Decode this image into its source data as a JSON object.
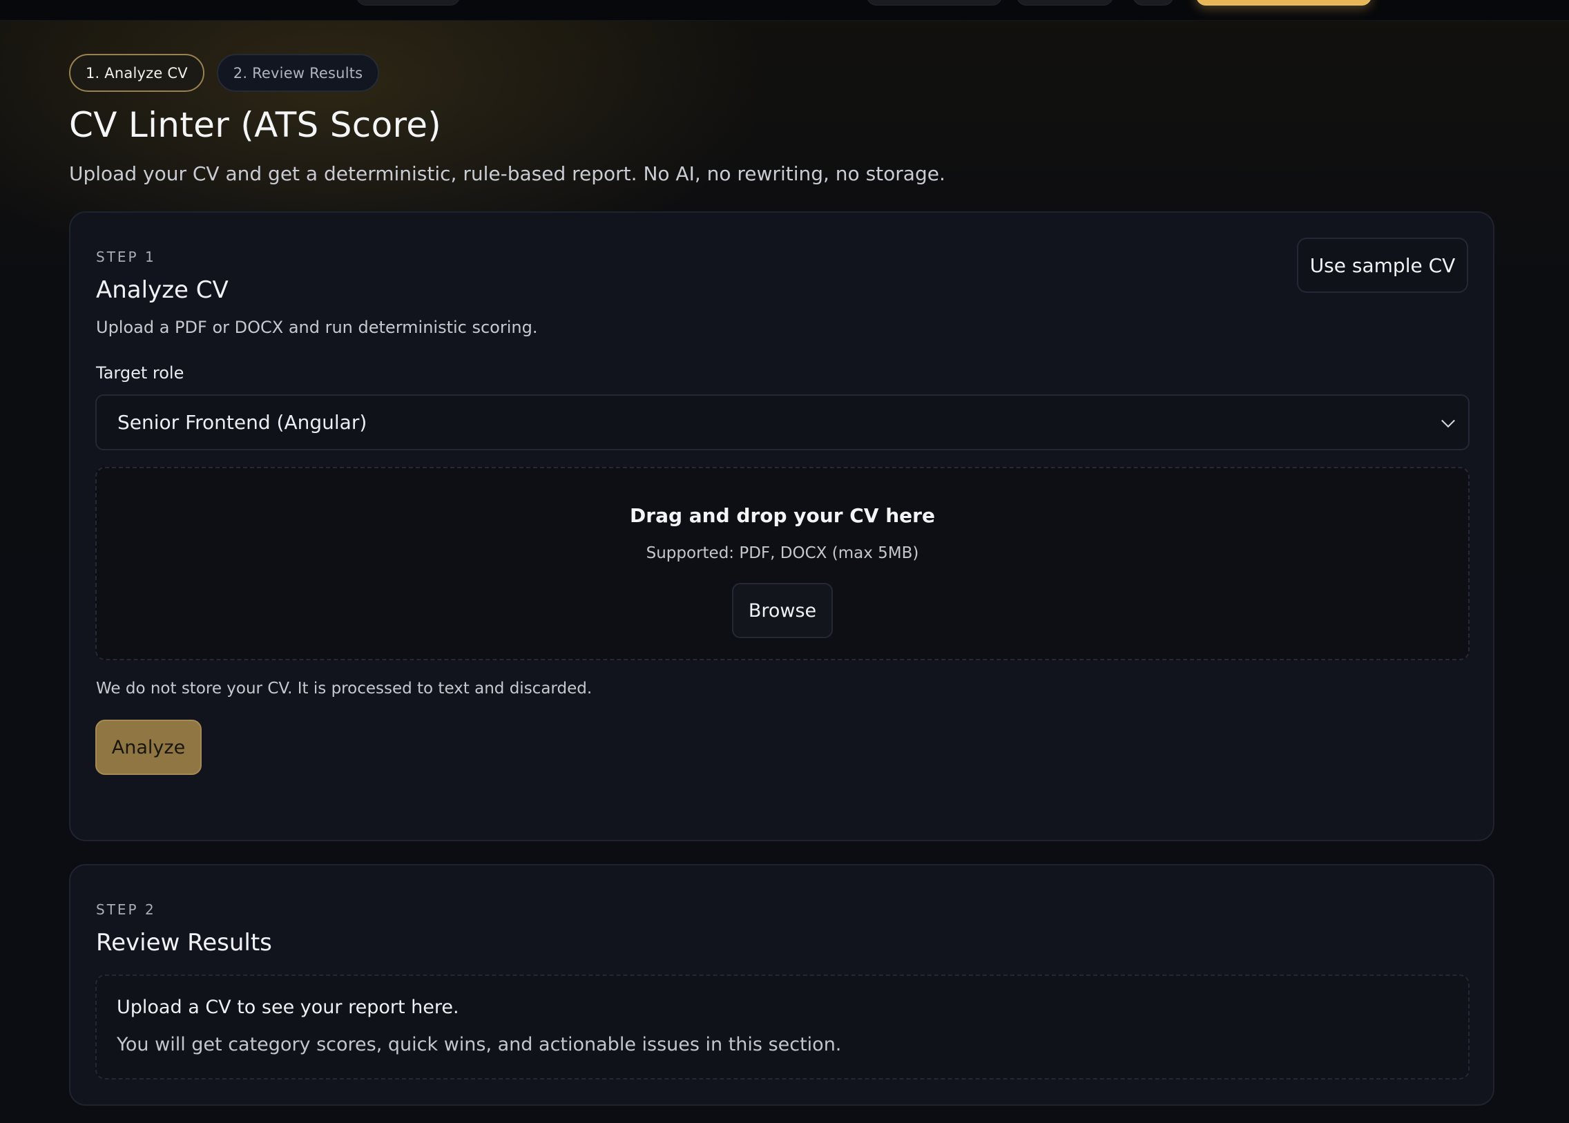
{
  "stepper": {
    "steps": [
      {
        "label": "1. Analyze CV",
        "active": true
      },
      {
        "label": "2. Review Results",
        "active": false
      }
    ]
  },
  "header": {
    "title": "CV Linter (ATS Score)",
    "subtitle": "Upload your CV and get a deterministic, rule-based report. No AI, no rewriting, no storage."
  },
  "step1": {
    "eyebrow": "STEP 1",
    "title": "Analyze CV",
    "description": "Upload a PDF or DOCX and run deterministic scoring.",
    "sample_button": "Use sample CV",
    "target_role": {
      "label": "Target role",
      "selected": "Senior Frontend (Angular)"
    },
    "dropzone": {
      "title": "Drag and drop your CV here",
      "supported": "Supported: PDF, DOCX (max 5MB)",
      "browse_button": "Browse"
    },
    "privacy_note": "We do not store your CV. It is processed to text and discarded.",
    "analyze_button": "Analyze"
  },
  "step2": {
    "eyebrow": "STEP 2",
    "title": "Review Results",
    "placeholder_title": "Upload a CV to see your report here.",
    "placeholder_body": "You will get category scores, quick wins, and actionable issues in this section."
  },
  "colors": {
    "accent": "#e8b75a",
    "analyze_button": "#8f7643",
    "card_background": "#11141c",
    "page_background": "#0b0d12"
  },
  "icons": {
    "select_chevron": "chevron-down-icon"
  }
}
